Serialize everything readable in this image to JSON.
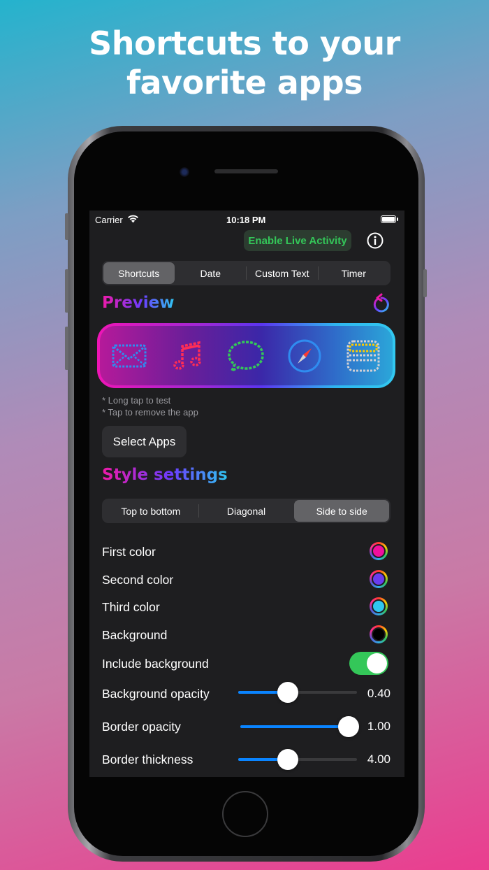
{
  "headline": {
    "line1": "Shortcuts to your",
    "line2": "favorite apps"
  },
  "status_bar": {
    "carrier": "Carrier",
    "time": "10:18 PM"
  },
  "header": {
    "live_activity_label": "Enable Live Activity"
  },
  "tabs": [
    {
      "label": "Shortcuts",
      "selected": true
    },
    {
      "label": "Date",
      "selected": false
    },
    {
      "label": "Custom Text",
      "selected": false
    },
    {
      "label": "Timer",
      "selected": false
    }
  ],
  "preview": {
    "title": "Preview",
    "apps": [
      "mail-icon",
      "music-icon",
      "messages-icon",
      "safari-icon",
      "wallet-icon"
    ],
    "hint1": "* Long tap to test",
    "hint2": "* Tap to remove the app"
  },
  "select_apps_label": "Select Apps",
  "style": {
    "title": "Style settings",
    "directions": [
      {
        "label": "Top to bottom",
        "selected": false
      },
      {
        "label": "Diagonal",
        "selected": false
      },
      {
        "label": "Side to side",
        "selected": true
      }
    ],
    "colors": [
      {
        "label": "First color",
        "value": "#f00f9e"
      },
      {
        "label": "Second color",
        "value": "#6a3cf0"
      },
      {
        "label": "Third color",
        "value": "#2fc6f0"
      },
      {
        "label": "Background",
        "value": "#000000"
      }
    ],
    "include_background": {
      "label": "Include background",
      "on": true
    },
    "sliders": [
      {
        "label": "Background opacity",
        "display": "0.40",
        "fraction": 0.4
      },
      {
        "label": "Border opacity",
        "display": "1.00",
        "fraction": 1.0
      },
      {
        "label": "Border thickness",
        "display": "4.00",
        "fraction": 0.4
      }
    ]
  }
}
